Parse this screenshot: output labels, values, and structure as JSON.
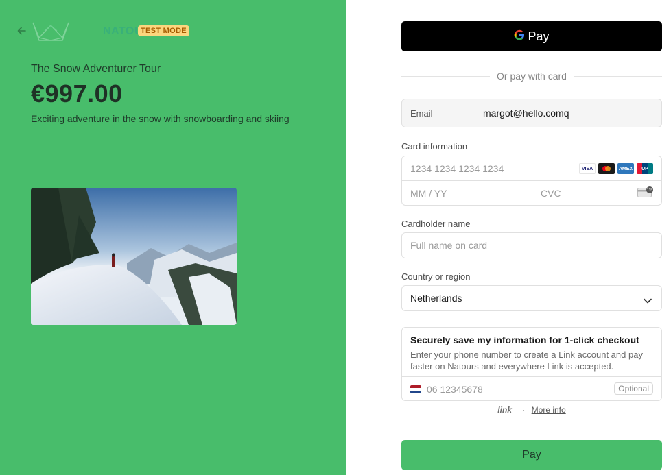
{
  "brand": {
    "logo_text": "NATOURS",
    "badge": "TEST MODE"
  },
  "product": {
    "name": "The Snow Adventurer Tour",
    "price": "€997.00",
    "description": "Exciting adventure in the snow with snowboarding and skiing"
  },
  "payment": {
    "gpay_label": "Pay",
    "divider_text": "Or pay with card",
    "email_label": "Email",
    "email_value": "margot@hello.comq",
    "card_info_label": "Card information",
    "card_number_placeholder": "1234 1234 1234 1234",
    "expiry_placeholder": "MM / YY",
    "cvc_placeholder": "CVC",
    "cardholder_label": "Cardholder name",
    "cardholder_placeholder": "Full name on card",
    "country_label": "Country or region",
    "country_value": "Netherlands",
    "card_brands": [
      "VISA",
      "Mastercard",
      "Amex",
      "UnionPay"
    ],
    "cvc_badge": "135"
  },
  "link": {
    "title": "Securely save my information for 1-click checkout",
    "description": "Enter your phone number to create a Link account and pay faster on Natours and everywhere Link is accepted.",
    "phone_placeholder": "06 12345678",
    "optional_label": "Optional",
    "logo": "link",
    "dot": "·",
    "more_info": "More info"
  },
  "pay_button": "Pay",
  "colors": {
    "left_bg": "#48bd6b",
    "pay_button_bg": "#48bd6b",
    "badge_bg": "#fdd67e",
    "badge_text": "#a65b00"
  }
}
